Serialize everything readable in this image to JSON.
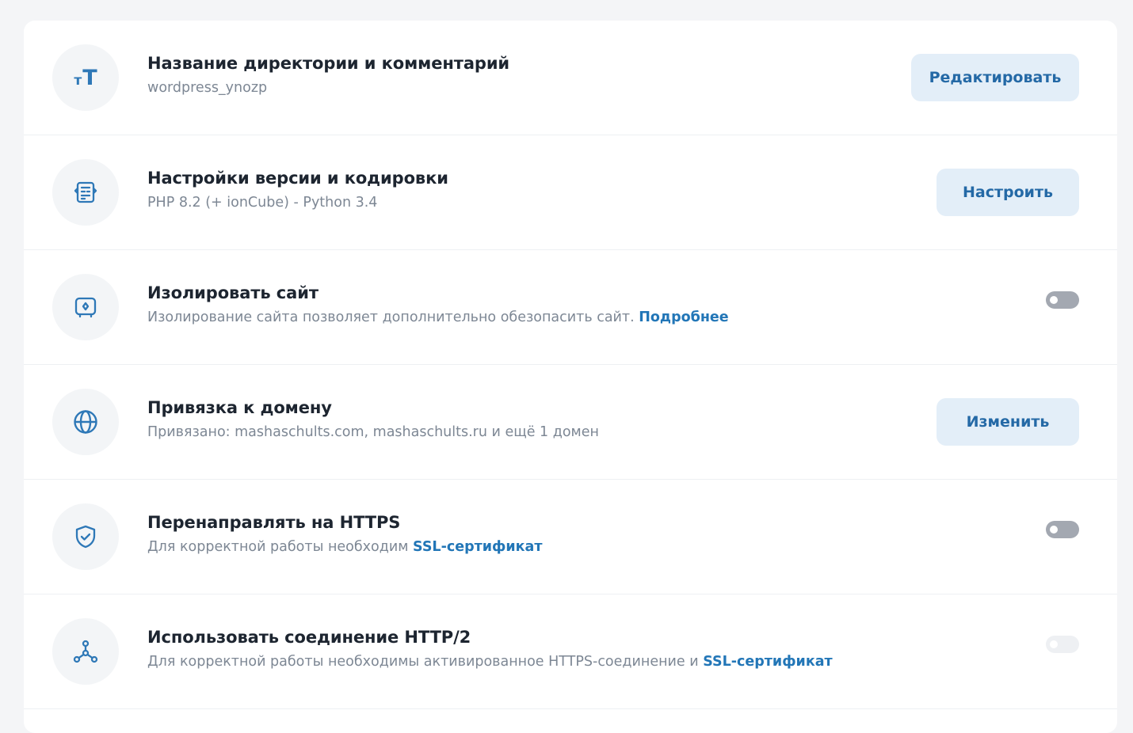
{
  "settings": [
    {
      "icon": "text-size-icon",
      "icon_small": "т",
      "icon_big": "Т",
      "title": "Название директории и комментарий",
      "subtitle": "wordpress_ynozp",
      "button": "Редактировать"
    },
    {
      "icon": "code-file-icon",
      "title": "Настройки версии и кодировки",
      "subtitle": "PHP 8.2 (+ ionCube) - Python 3.4",
      "button": "Настроить"
    },
    {
      "icon": "safe-icon",
      "title": "Изолировать сайт",
      "subtitle": "Изолирование сайта позволяет дополнительно обезопасить сайт.",
      "link": "Подробнее",
      "toggle_on": false
    },
    {
      "icon": "globe-icon",
      "title": "Привязка к домену",
      "subtitle": "Привязано: mashaschults.com, mashaschults.ru и ещё 1 домен",
      "button": "Изменить"
    },
    {
      "icon": "shield-check-icon",
      "title": "Перенаправлять на HTTPS",
      "subtitle": "Для корректной работы необходим",
      "link": "SSL-сертификат",
      "toggle_on": false
    },
    {
      "icon": "network-icon",
      "title": "Использовать соединение HTTP/2",
      "subtitle": "Для корректной работы необходимы активированное HTTPS-соединение и",
      "link": "SSL-сертификат",
      "toggle_on": false,
      "toggle_disabled": true
    }
  ],
  "colors": {
    "accent": "#2276b7",
    "button_bg": "#e3eef8",
    "toggle_off": "#a3a8b1",
    "toggle_disabled": "#eef0f3"
  }
}
